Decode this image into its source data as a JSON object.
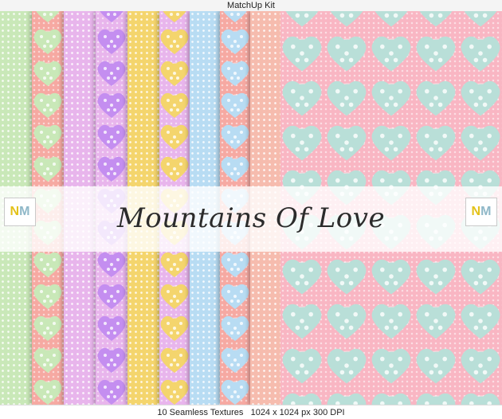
{
  "window": {
    "title": "MatchUp Kit"
  },
  "banner": {
    "title": "Mountains Of Love"
  },
  "logo": {
    "letter1": "N",
    "letter2": "M"
  },
  "footer": {
    "caption": "10 Seamless Textures   1024 x 1024 px 300 DPI"
  },
  "palette": {
    "green": "#c9e8b8",
    "coral": "#f6a9a2",
    "pink": "#f9b6c3",
    "lilac": "#e8b5ec",
    "purple": "#c48ef0",
    "yellow": "#f4d56d",
    "blue": "#b8dcf3",
    "mint": "#b9dfd8",
    "peach": "#f6bcae"
  },
  "textures": [
    {
      "name": "green-dots",
      "base": "green",
      "accent": "green"
    },
    {
      "name": "coral-hearts",
      "base": "coral",
      "accent": "green"
    },
    {
      "name": "lilac-dots",
      "base": "lilac",
      "accent": "lilac"
    },
    {
      "name": "purple-hearts",
      "base": "lilac",
      "accent": "purple"
    },
    {
      "name": "yellow-dots",
      "base": "yellow",
      "accent": "yellow"
    },
    {
      "name": "multi-hearts",
      "base": "lilac",
      "accent": "yellow"
    },
    {
      "name": "blue-dots",
      "base": "blue",
      "accent": "blue"
    },
    {
      "name": "pink-hearts",
      "base": "coral",
      "accent": "blue"
    },
    {
      "name": "peach-dots",
      "base": "peach",
      "accent": "peach"
    },
    {
      "name": "pink-mint-hearts",
      "base": "pink",
      "accent": "mint"
    }
  ]
}
